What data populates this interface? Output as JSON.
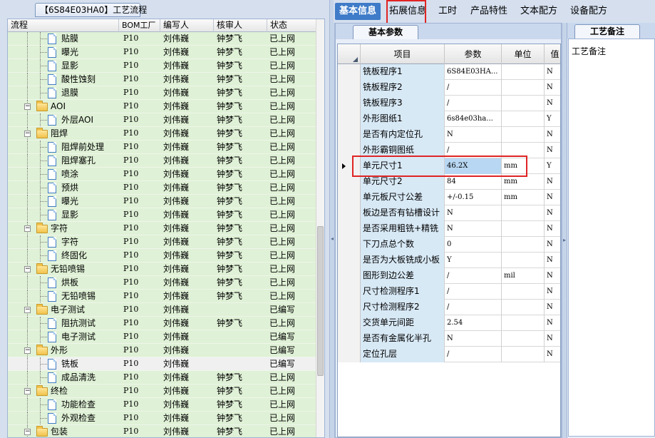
{
  "left_tab": {
    "label": "【6S84E03HA0】工艺流程"
  },
  "tree": {
    "headers": [
      "流程",
      "BOM工厂",
      "编写人",
      "核审人",
      "状态"
    ],
    "rows": [
      {
        "name": "贴膜",
        "type": "leaf",
        "bom": "P10",
        "writer": "刘伟巍",
        "reviewer": "钟梦飞",
        "status": "已上网"
      },
      {
        "name": "曝光",
        "type": "leaf",
        "bom": "P10",
        "writer": "刘伟巍",
        "reviewer": "钟梦飞",
        "status": "已上网"
      },
      {
        "name": "显影",
        "type": "leaf",
        "bom": "P10",
        "writer": "刘伟巍",
        "reviewer": "钟梦飞",
        "status": "已上网"
      },
      {
        "name": "酸性蚀刻",
        "type": "leaf",
        "bom": "P10",
        "writer": "刘伟巍",
        "reviewer": "钟梦飞",
        "status": "已上网"
      },
      {
        "name": "退膜",
        "type": "leaf",
        "bom": "P10",
        "writer": "刘伟巍",
        "reviewer": "钟梦飞",
        "status": "已上网"
      },
      {
        "name": "AOI",
        "type": "folder",
        "bom": "P10",
        "writer": "刘伟巍",
        "reviewer": "钟梦飞",
        "status": "已上网"
      },
      {
        "name": "外层AOI",
        "type": "leaf",
        "bom": "P10",
        "writer": "刘伟巍",
        "reviewer": "钟梦飞",
        "status": "已上网"
      },
      {
        "name": "阻焊",
        "type": "folder",
        "bom": "P10",
        "writer": "刘伟巍",
        "reviewer": "钟梦飞",
        "status": "已上网"
      },
      {
        "name": "阻焊前处理",
        "type": "leaf",
        "bom": "P10",
        "writer": "刘伟巍",
        "reviewer": "钟梦飞",
        "status": "已上网"
      },
      {
        "name": "阻焊塞孔",
        "type": "leaf",
        "bom": "P10",
        "writer": "刘伟巍",
        "reviewer": "钟梦飞",
        "status": "已上网"
      },
      {
        "name": "喷涂",
        "type": "leaf",
        "bom": "P10",
        "writer": "刘伟巍",
        "reviewer": "钟梦飞",
        "status": "已上网"
      },
      {
        "name": "预烘",
        "type": "leaf",
        "bom": "P10",
        "writer": "刘伟巍",
        "reviewer": "钟梦飞",
        "status": "已上网"
      },
      {
        "name": "曝光",
        "type": "leaf",
        "bom": "P10",
        "writer": "刘伟巍",
        "reviewer": "钟梦飞",
        "status": "已上网"
      },
      {
        "name": "显影",
        "type": "leaf",
        "bom": "P10",
        "writer": "刘伟巍",
        "reviewer": "钟梦飞",
        "status": "已上网"
      },
      {
        "name": "字符",
        "type": "folder",
        "bom": "P10",
        "writer": "刘伟巍",
        "reviewer": "钟梦飞",
        "status": "已上网"
      },
      {
        "name": "字符",
        "type": "leaf",
        "bom": "P10",
        "writer": "刘伟巍",
        "reviewer": "钟梦飞",
        "status": "已上网"
      },
      {
        "name": "终固化",
        "type": "leaf",
        "bom": "P10",
        "writer": "刘伟巍",
        "reviewer": "钟梦飞",
        "status": "已上网"
      },
      {
        "name": "无铅喷锡",
        "type": "folder",
        "bom": "P10",
        "writer": "刘伟巍",
        "reviewer": "钟梦飞",
        "status": "已上网"
      },
      {
        "name": "烘板",
        "type": "leaf",
        "bom": "P10",
        "writer": "刘伟巍",
        "reviewer": "钟梦飞",
        "status": "已上网"
      },
      {
        "name": "无铅喷锡",
        "type": "leaf",
        "bom": "P10",
        "writer": "刘伟巍",
        "reviewer": "钟梦飞",
        "status": "已上网"
      },
      {
        "name": "电子测试",
        "type": "folder",
        "bom": "P10",
        "writer": "刘伟巍",
        "reviewer": "",
        "status": "已编写"
      },
      {
        "name": "阻抗测试",
        "type": "leaf",
        "bom": "P10",
        "writer": "刘伟巍",
        "reviewer": "钟梦飞",
        "status": "已上网"
      },
      {
        "name": "电子测试",
        "type": "leaf",
        "bom": "P10",
        "writer": "刘伟巍",
        "reviewer": "",
        "status": "已编写"
      },
      {
        "name": "外形",
        "type": "folder",
        "bom": "P10",
        "writer": "刘伟巍",
        "reviewer": "",
        "status": "已编写"
      },
      {
        "name": "铣板",
        "type": "leaf",
        "bom": "P10",
        "writer": "刘伟巍",
        "reviewer": "",
        "status": "已编写",
        "selected": true
      },
      {
        "name": "成品清洗",
        "type": "leaf",
        "bom": "P10",
        "writer": "刘伟巍",
        "reviewer": "钟梦飞",
        "status": "已上网"
      },
      {
        "name": "终检",
        "type": "folder",
        "bom": "P10",
        "writer": "刘伟巍",
        "reviewer": "钟梦飞",
        "status": "已上网"
      },
      {
        "name": "功能检查",
        "type": "leaf",
        "bom": "P10",
        "writer": "刘伟巍",
        "reviewer": "钟梦飞",
        "status": "已上网"
      },
      {
        "name": "外观检查",
        "type": "leaf",
        "bom": "P10",
        "writer": "刘伟巍",
        "reviewer": "钟梦飞",
        "status": "已上网"
      },
      {
        "name": "包装",
        "type": "folder",
        "bom": "P10",
        "writer": "刘伟巍",
        "reviewer": "钟梦飞",
        "status": "已上网"
      }
    ]
  },
  "top_tabs": [
    {
      "label": "基本信息",
      "active": true
    },
    {
      "label": "拓展信息",
      "active": false
    },
    {
      "label": "工时",
      "active": false
    },
    {
      "label": "产品特性",
      "active": false
    },
    {
      "label": "文本配方",
      "active": false
    },
    {
      "label": "设备配方",
      "active": false
    }
  ],
  "panel_tab": {
    "label": "基本参数"
  },
  "grid": {
    "headers": [
      "项目",
      "参数",
      "单位",
      "值"
    ],
    "rows": [
      {
        "item": "铣板程序1",
        "value": "6S84E03HA...",
        "unit": "",
        "last": "N"
      },
      {
        "item": "铣板程序2",
        "value": "/",
        "unit": "",
        "last": "N"
      },
      {
        "item": "铣板程序3",
        "value": "/",
        "unit": "",
        "last": "N"
      },
      {
        "item": "外形图纸1",
        "value": "6s84e03ha...",
        "unit": "",
        "last": "Y"
      },
      {
        "item": "是否有内定位孔",
        "value": "N",
        "unit": "",
        "last": "N"
      },
      {
        "item": "外形霸铜图纸",
        "value": "/",
        "unit": "",
        "last": "N"
      },
      {
        "item": "单元尺寸1",
        "value": "46.2X",
        "unit": "mm",
        "last": "Y",
        "current": true
      },
      {
        "item": "单元尺寸2",
        "value": "84",
        "unit": "mm",
        "last": "N"
      },
      {
        "item": "单元板尺寸公差",
        "value": "+/-0.15",
        "unit": "mm",
        "last": "N"
      },
      {
        "item": "板边是否有钻槽设计",
        "value": "N",
        "unit": "",
        "last": "N"
      },
      {
        "item": "是否采用粗铣+精铣",
        "value": "N",
        "unit": "",
        "last": "N"
      },
      {
        "item": "下刀点总个数",
        "value": "0",
        "unit": "",
        "last": "N"
      },
      {
        "item": "是否为大板铣成小板",
        "value": "Y",
        "unit": "",
        "last": "N"
      },
      {
        "item": "图形到边公差",
        "value": "/",
        "unit": "mil",
        "last": "N"
      },
      {
        "item": "尺寸检测程序1",
        "value": "/",
        "unit": "",
        "last": "N"
      },
      {
        "item": "尺寸检测程序2",
        "value": "/",
        "unit": "",
        "last": "N"
      },
      {
        "item": "交货单元间距",
        "value": "2.54",
        "unit": "",
        "last": "N"
      },
      {
        "item": "是否有金属化半孔",
        "value": "N",
        "unit": "",
        "last": "N"
      },
      {
        "item": "定位孔层",
        "value": "/",
        "unit": "",
        "last": "N"
      }
    ]
  },
  "note_tab": {
    "label": "工艺备注"
  },
  "note_body": {
    "label": "工艺备注"
  },
  "colors": {
    "accent": "#3e7bc8",
    "row_green": "#dff1d6",
    "highlight": "#e02424"
  }
}
